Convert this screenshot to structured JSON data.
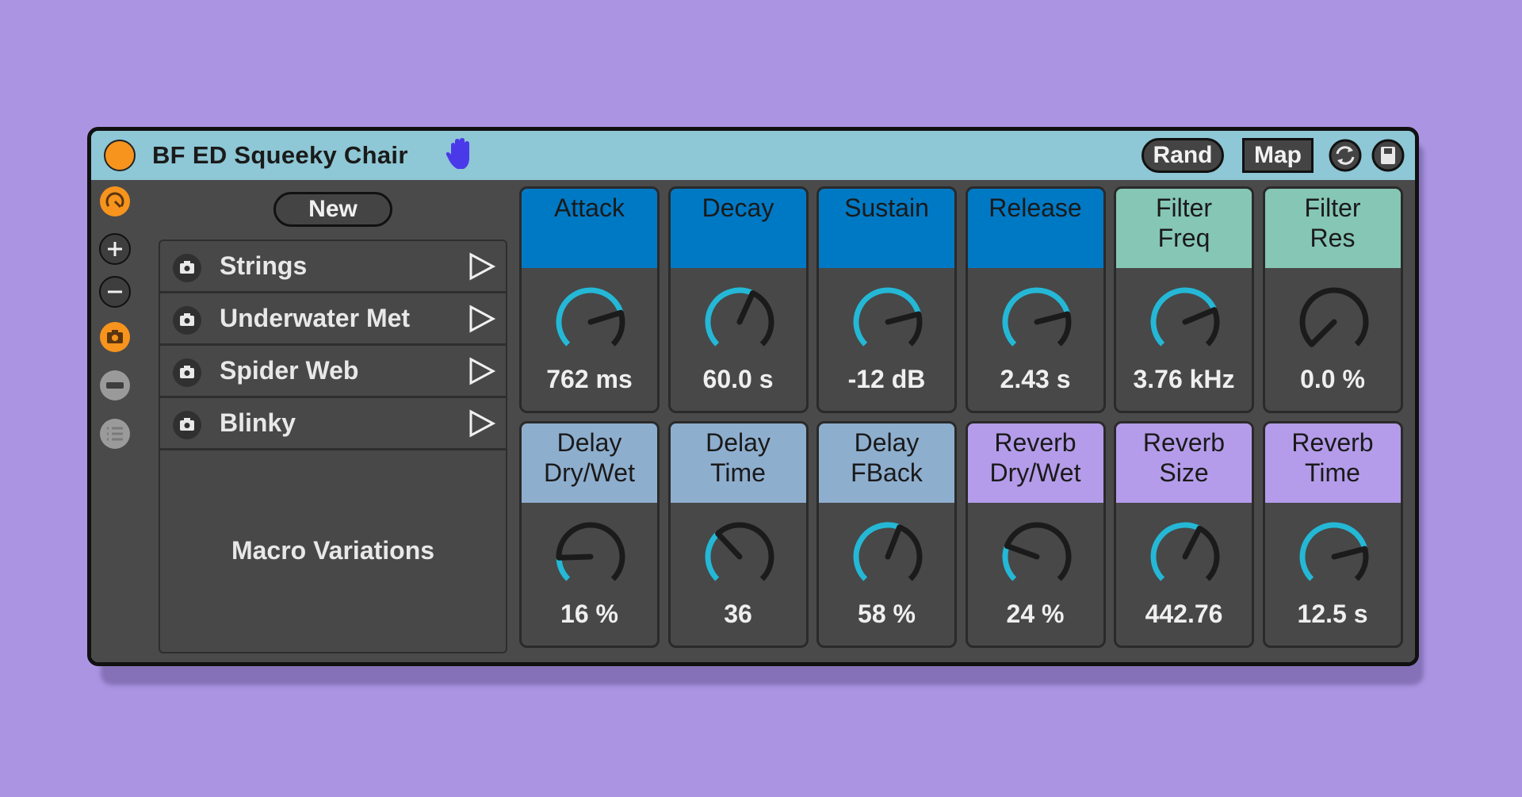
{
  "device": {
    "title": "BF ED Squeeky Chair",
    "rand_label": "Rand",
    "map_label": "Map",
    "colors": {
      "accent": "#f7941d",
      "titlebar": "#8ec7d5",
      "panel": "#4a4a4a",
      "knob_arc": "#25b8d6",
      "adsr_header": "#0079c4",
      "filter_header": "#86c6b4",
      "delay_header": "#8eaece",
      "reverb_header": "#b49cea"
    }
  },
  "side_icons": [
    "compare-icon",
    "plus-icon",
    "minus-icon",
    "camera-icon",
    "bar-icon",
    "list-icon"
  ],
  "macro_variations": {
    "new_label": "New",
    "caption": "Macro Variations",
    "items": [
      {
        "label": "Strings"
      },
      {
        "label": "Underwater Met"
      },
      {
        "label": "Spider Web"
      },
      {
        "label": "Blinky"
      }
    ]
  },
  "knobs": [
    {
      "label": "Attack",
      "value": "762 ms",
      "level": 0.77,
      "group": "adsr"
    },
    {
      "label": "Decay",
      "value": "60.0 s",
      "level": 0.59,
      "group": "adsr"
    },
    {
      "label": "Sustain",
      "value": "-12 dB",
      "level": 0.78,
      "group": "adsr"
    },
    {
      "label": "Release",
      "value": "2.43 s",
      "level": 0.78,
      "group": "adsr"
    },
    {
      "label": "Filter\nFreq",
      "value": "3.76 kHz",
      "level": 0.75,
      "group": "filter"
    },
    {
      "label": "Filter\nRes",
      "value": "0.0 %",
      "level": 0.0,
      "group": "filter"
    },
    {
      "label": "Delay\nDry/Wet",
      "value": "16 %",
      "level": 0.16,
      "group": "delay"
    },
    {
      "label": "Delay\nTime",
      "value": "36",
      "level": 0.34,
      "group": "delay"
    },
    {
      "label": "Delay\nFBack",
      "value": "58 %",
      "level": 0.58,
      "group": "delay"
    },
    {
      "label": "Reverb\nDry/Wet",
      "value": "24 %",
      "level": 0.24,
      "group": "reverb"
    },
    {
      "label": "Reverb\nSize",
      "value": "442.76",
      "level": 0.6,
      "group": "reverb"
    },
    {
      "label": "Reverb\nTime",
      "value": "12.5 s",
      "level": 0.78,
      "group": "reverb"
    }
  ]
}
